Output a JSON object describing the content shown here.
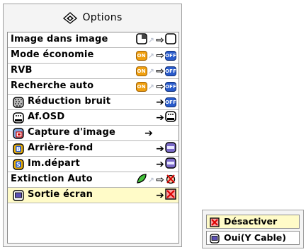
{
  "window": {
    "title": "Options",
    "title_icon": "gear-icon"
  },
  "arrow_glyph": "⇨",
  "menu": {
    "items": [
      {
        "label": "Image dans image",
        "left_icon": null,
        "current_icon": "pip-icon",
        "target_icon": "pip-off-icon"
      },
      {
        "label": "Mode économie",
        "left_icon": null,
        "current_badge": "ON",
        "target_badge": "OFF"
      },
      {
        "label": "RVB",
        "left_icon": null,
        "current_badge": "ON",
        "target_badge": "OFF"
      },
      {
        "label": "Recherche auto",
        "left_icon": null,
        "current_badge": "ON",
        "target_badge": "OFF"
      },
      {
        "label": "Réduction bruit",
        "left_icon": "noise-reduction-icon",
        "target_badge": "OFF"
      },
      {
        "label": "Af.OSD",
        "left_icon": "osd-icon",
        "target_icon": "osd-icon"
      },
      {
        "label": "Capture d'image",
        "left_icon": "image-capture-icon"
      },
      {
        "label": "Arrière-fond",
        "left_icon": "background-icon",
        "target_icon": "sharp-screen-icon"
      },
      {
        "label": "Im.départ",
        "left_icon": "startup-image-icon",
        "target_icon": "sharp-screen-icon"
      },
      {
        "label": "Extinction Auto",
        "left_icon": null,
        "current_icon": "leaf-icon",
        "target_icon": "auto-power-off-icon"
      },
      {
        "label": "Sortie écran",
        "left_icon": "monitor-out-icon",
        "target_icon": "disabled-x-icon",
        "selected": true
      }
    ]
  },
  "submenu": {
    "options": [
      {
        "label": "Désactiver",
        "icon": "disabled-x-icon",
        "selected": true
      },
      {
        "label": "Oui(Y Cable)",
        "icon": "monitor-out-icon",
        "selected": false
      }
    ]
  },
  "colors": {
    "badge_on": "#f0a010",
    "badge_off": "#2a5ccc",
    "selected_row": "#fffbc8"
  }
}
